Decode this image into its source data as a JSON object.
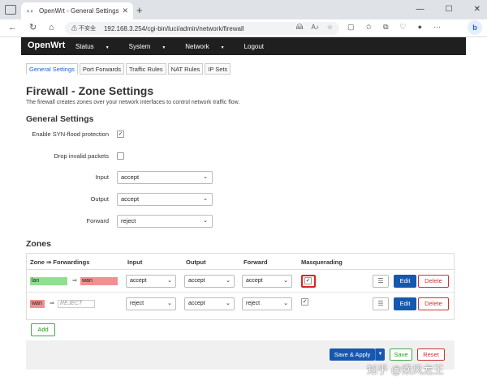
{
  "browser": {
    "tab_title": "OpenWrt - General Settings - Lu",
    "tab_close": "✕",
    "new_tab": "+",
    "security_label": "⚠ 不安全",
    "url": "192.168.3.254/cgi-bin/luci/admin/network/firewall",
    "window_controls": [
      "—",
      "☐",
      "✕"
    ]
  },
  "header": {
    "brand": "OpenWrt",
    "menu": [
      {
        "label": "Status"
      },
      {
        "label": "System"
      },
      {
        "label": "Network"
      },
      {
        "label": "Logout"
      }
    ]
  },
  "tabs": [
    "General Settings",
    "Port Forwards",
    "Traffic Rules",
    "NAT Rules",
    "IP Sets"
  ],
  "page": {
    "title": "Firewall - Zone Settings",
    "description": "The firewall creates zones over your network interfaces to control network traffic flow.",
    "general_heading": "General Settings"
  },
  "general": {
    "syn_label": "Enable SYN-flood protection",
    "syn_checked": "✓",
    "drop_label": "Drop invalid packets",
    "input_label": "Input",
    "input_value": "accept",
    "output_label": "Output",
    "output_value": "accept",
    "forward_label": "Forward",
    "forward_value": "reject"
  },
  "zones": {
    "heading": "Zones",
    "columns": [
      "Zone ⇒ Forwardings",
      "Input",
      "Output",
      "Forward",
      "Masquerading"
    ],
    "rows": [
      {
        "zone": "lan",
        "arrow": "⇒",
        "dest": "wan",
        "input": "accept",
        "output": "accept",
        "forward": "accept",
        "masq": "✓",
        "edit": "Edit",
        "delete": "Delete"
      },
      {
        "zone": "wan",
        "arrow": "⇒",
        "dest": "REJECT",
        "input": "reject",
        "output": "accept",
        "forward": "reject",
        "masq": "✓",
        "edit": "Edit",
        "delete": "Delete"
      }
    ],
    "add_label": "Add"
  },
  "actions": {
    "save_apply": "Save & Apply",
    "save": "Save",
    "reset": "Reset"
  },
  "watermark": "知乎 @乘风龙王",
  "colors": {
    "header_bg": "#1f1f1f",
    "lan_zone": "#90e090",
    "wan_zone": "#f09090",
    "primary": "#1658b0",
    "highlight": "#dd2222"
  }
}
